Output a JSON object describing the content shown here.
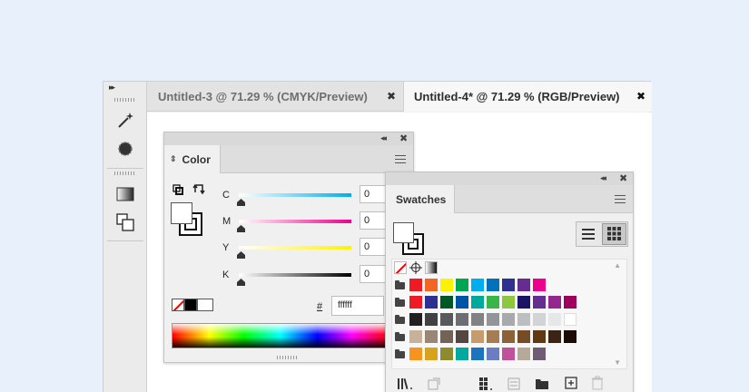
{
  "tabs": [
    {
      "label": "Untitled-3 @ 71.29 % (CMYK/Preview)",
      "active": false
    },
    {
      "label": "Untitled-4* @ 71.29 % (RGB/Preview)",
      "active": true
    }
  ],
  "close_glyph": "✖",
  "collapse_glyph": "◂◂",
  "color_panel": {
    "title": "Color",
    "sliders": [
      {
        "label": "C",
        "value": "0",
        "gradient_end": "#00aeef"
      },
      {
        "label": "M",
        "value": "0",
        "gradient_end": "#ec008c"
      },
      {
        "label": "Y",
        "value": "0",
        "gradient_end": "#fff200"
      },
      {
        "label": "K",
        "value": "0",
        "gradient_end": "#000000"
      }
    ],
    "hex_prefix": "#",
    "hex_value": "ffffff"
  },
  "swatches_panel": {
    "title": "Swatches",
    "rows": [
      [
        "#ed1c24",
        "#f26522",
        "#fff200",
        "#00a651",
        "#00aeef",
        "#0072bc",
        "#2e3192",
        "#662d91",
        "#ec008c"
      ],
      [
        "#ed1c24",
        "#2e3192",
        "#005826",
        "#0054a6",
        "#00a99d",
        "#39b54a",
        "#8dc63f",
        "#1b1464",
        "#662d91",
        "#92278f",
        "#9e005d"
      ],
      [
        "#231f20",
        "#414042",
        "#58595b",
        "#6d6e71",
        "#808285",
        "#939598",
        "#a7a9ac",
        "#bcbec0",
        "#d1d3d4",
        "#e6e7e8",
        "#ffffff"
      ],
      [
        "#c7b299",
        "#998675",
        "#736357",
        "#534741",
        "#c69c6d",
        "#a67c52",
        "#8c6239",
        "#754c24",
        "#603913",
        "#3c2415",
        "#1b0a05"
      ],
      [
        "#f7941d",
        "#d9a21b",
        "#8e8b2f",
        "#00a99d",
        "#1b75bc",
        "#6c7dc4",
        "#c2519b",
        "#b7a99a",
        "#6f5b73"
      ]
    ]
  }
}
